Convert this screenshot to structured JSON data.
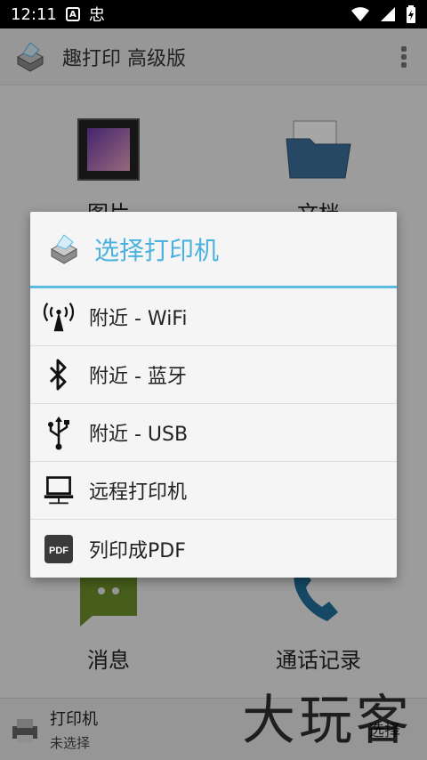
{
  "status_bar": {
    "time": "12:11",
    "a_badge": "A",
    "app_icon_text": "忠"
  },
  "app_bar": {
    "title": "趣打印 高级版"
  },
  "grid": {
    "tiles": [
      {
        "label": "图片"
      },
      {
        "label": "文档"
      },
      {
        "label": "消息"
      },
      {
        "label": "通话记录"
      }
    ]
  },
  "bottom_bar": {
    "printer_title": "打印机",
    "printer_subtitle": "未选择",
    "select_label": "选择",
    "watermark": "大玩客"
  },
  "dialog": {
    "title": "选择打印机",
    "items": [
      {
        "label": "附近 - WiFi",
        "icon": "wifi-tower-icon"
      },
      {
        "label": "附近 - 蓝牙",
        "icon": "bluetooth-icon"
      },
      {
        "label": "附近 - USB",
        "icon": "usb-icon"
      },
      {
        "label": "远程打印机",
        "icon": "remote-computer-icon"
      },
      {
        "label": "列印成PDF",
        "icon": "pdf-icon"
      }
    ]
  },
  "colors": {
    "accent": "#4bb1df",
    "accent_line": "#5bbbe3",
    "overlay": "#000000"
  }
}
